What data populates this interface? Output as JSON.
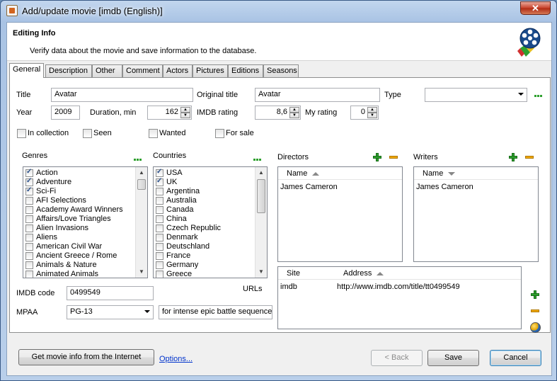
{
  "window": {
    "title": "Add/update movie [imdb (English)]",
    "close_label": "✕"
  },
  "header": {
    "title": "Editing Info",
    "subtitle": "Verify data about the movie and save information to the database."
  },
  "tabs": [
    {
      "label": "General",
      "active": true
    },
    {
      "label": "Description"
    },
    {
      "label": "Other"
    },
    {
      "label": "Comment"
    },
    {
      "label": "Actors"
    },
    {
      "label": "Pictures"
    },
    {
      "label": "Editions"
    },
    {
      "label": "Seasons"
    }
  ],
  "general": {
    "title_label": "Title",
    "title_value": "Avatar",
    "original_title_label": "Original title",
    "original_title_value": "Avatar",
    "type_label": "Type",
    "type_value": "",
    "year_label": "Year",
    "year_value": "2009",
    "duration_label": "Duration, min",
    "duration_value": "162",
    "imdb_rating_label": "IMDB rating",
    "imdb_rating_value": "8,6",
    "my_rating_label": "My rating",
    "my_rating_value": "0",
    "in_collection_label": "In collection",
    "seen_label": "Seen",
    "wanted_label": "Wanted",
    "for_sale_label": "For sale",
    "genres_label": "Genres",
    "countries_label": "Countries",
    "directors_label": "Directors",
    "writers_label": "Writers",
    "name_col": "Name",
    "site_col": "Site",
    "address_col": "Address",
    "urls_label": "URLs",
    "imdb_code_label": "IMDB code",
    "imdb_code_value": "0499549",
    "mpaa_label": "MPAA",
    "mpaa_value": "PG-13",
    "mpaa_reason_value": "for intense epic battle sequences"
  },
  "genres": [
    {
      "label": "Action",
      "checked": true
    },
    {
      "label": "Adventure",
      "checked": true
    },
    {
      "label": "Sci-Fi",
      "checked": true
    },
    {
      "label": "AFI Selections"
    },
    {
      "label": "Academy Award Winners"
    },
    {
      "label": "Affairs/Love Triangles"
    },
    {
      "label": "Alien Invasions"
    },
    {
      "label": "Aliens"
    },
    {
      "label": "American Civil War"
    },
    {
      "label": "Ancient Greece / Rome"
    },
    {
      "label": "Animals & Nature"
    },
    {
      "label": "Animated Animals"
    }
  ],
  "countries": [
    {
      "label": "USA",
      "checked": true
    },
    {
      "label": "UK",
      "checked": true
    },
    {
      "label": "Argentina"
    },
    {
      "label": "Australia"
    },
    {
      "label": "Canada"
    },
    {
      "label": "China"
    },
    {
      "label": "Czech Republic"
    },
    {
      "label": "Denmark"
    },
    {
      "label": "Deutschland"
    },
    {
      "label": "France"
    },
    {
      "label": "Germany"
    },
    {
      "label": "Greece"
    }
  ],
  "directors": [
    "James Cameron"
  ],
  "writers": [
    "James Cameron"
  ],
  "urls": [
    {
      "site": "imdb",
      "address": "http://www.imdb.com/title/tt0499549"
    }
  ],
  "footer": {
    "get_info_label": "Get movie info from the Internet",
    "options_label": "Options...",
    "back_label": "< Back",
    "save_label": "Save",
    "cancel_label": "Cancel"
  }
}
